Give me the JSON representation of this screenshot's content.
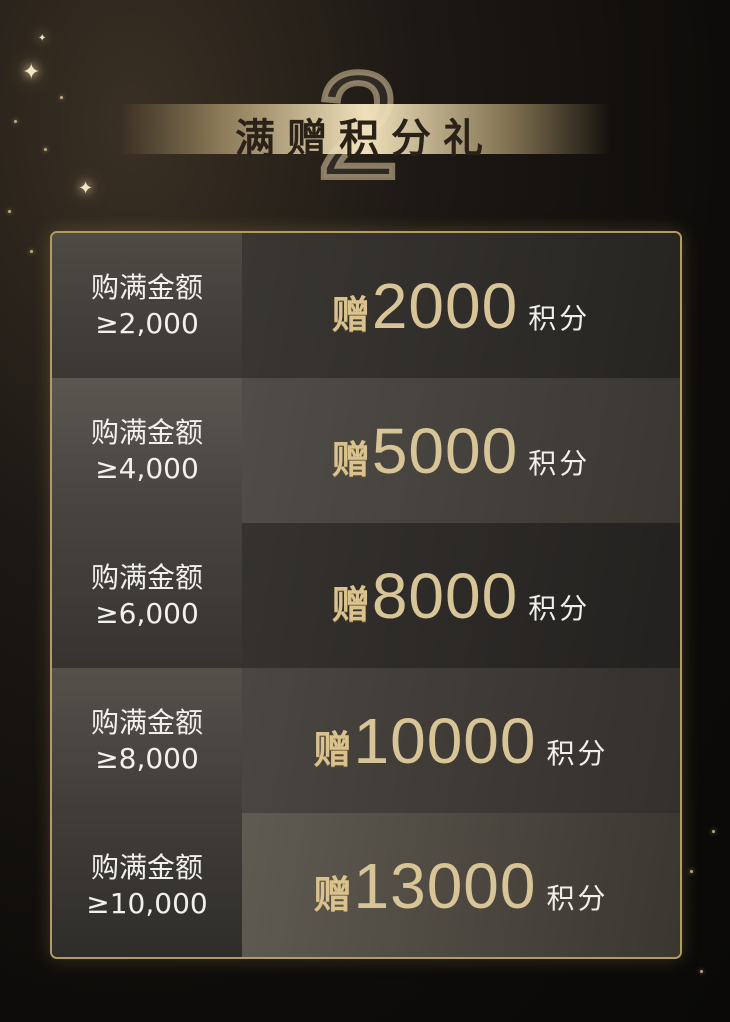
{
  "header": {
    "number": "2",
    "title": "满赠积分礼"
  },
  "tiers": [
    {
      "label": "购满金额",
      "threshold": "≥2,000",
      "gift_prefix": "赠",
      "points": "2000",
      "unit": "积分"
    },
    {
      "label": "购满金额",
      "threshold": "≥4,000",
      "gift_prefix": "赠",
      "points": "5000",
      "unit": "积分"
    },
    {
      "label": "购满金额",
      "threshold": "≥6,000",
      "gift_prefix": "赠",
      "points": "8000",
      "unit": "积分"
    },
    {
      "label": "购满金额",
      "threshold": "≥8,000",
      "gift_prefix": "赠",
      "points": "10000",
      "unit": "积分"
    },
    {
      "label": "购满金额",
      "threshold": "≥10,000",
      "gift_prefix": "赠",
      "points": "13000",
      "unit": "积分"
    }
  ],
  "colors": {
    "gold": "#d8c597",
    "border": "#b49a63",
    "background": "#0e0c0a"
  }
}
